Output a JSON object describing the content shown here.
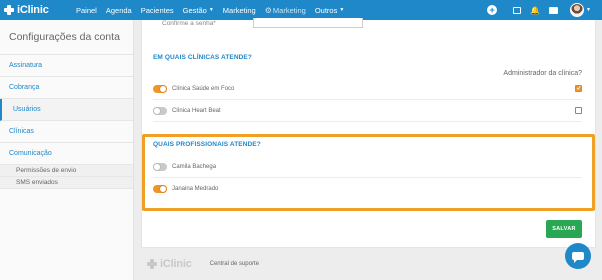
{
  "navbar": {
    "logo_text": "iClinic",
    "items": [
      "Painel",
      "Agenda",
      "Pacientes",
      "Gestão",
      "Marketing",
      "Marketing",
      "Outros"
    ],
    "icons": [
      "plus-circle-icon",
      "gift-icon",
      "bell-icon",
      "chat-icon",
      "avatar"
    ]
  },
  "sidebar": {
    "title": "Configurações da conta",
    "items": [
      "Assinatura",
      "Cobrança",
      "Usuários",
      "Clínicas",
      "Comunicação"
    ],
    "sub_items": [
      "Permissões de envio",
      "SMS enviados"
    ],
    "active": "Usuários"
  },
  "form": {
    "password_confirm_label": "Confirme a senha*",
    "clinics_title": "EM QUAIS CLÍNICAS ATENDE?",
    "admin_label": "Administrador da clínica?",
    "clinics": [
      {
        "name": "Clínica Saúde em Foco",
        "enabled": true,
        "admin": true
      },
      {
        "name": "Clínica Heart Beat",
        "enabled": false,
        "admin": false
      }
    ],
    "professionals_title": "QUAIS PROFISSIONAIS ATENDE?",
    "professionals": [
      {
        "name": "Camila Bachega",
        "enabled": false
      },
      {
        "name": "Janaina Medrado",
        "enabled": true
      }
    ],
    "save_label": "SALVAR"
  },
  "footer": {
    "logo_text": "iClinic",
    "support_link": "Central de suporte"
  },
  "colors": {
    "brand_blue": "#1e88c9",
    "toggle_on": "#f0952a",
    "highlight": "#f0a024",
    "save_green": "#2aa752"
  }
}
